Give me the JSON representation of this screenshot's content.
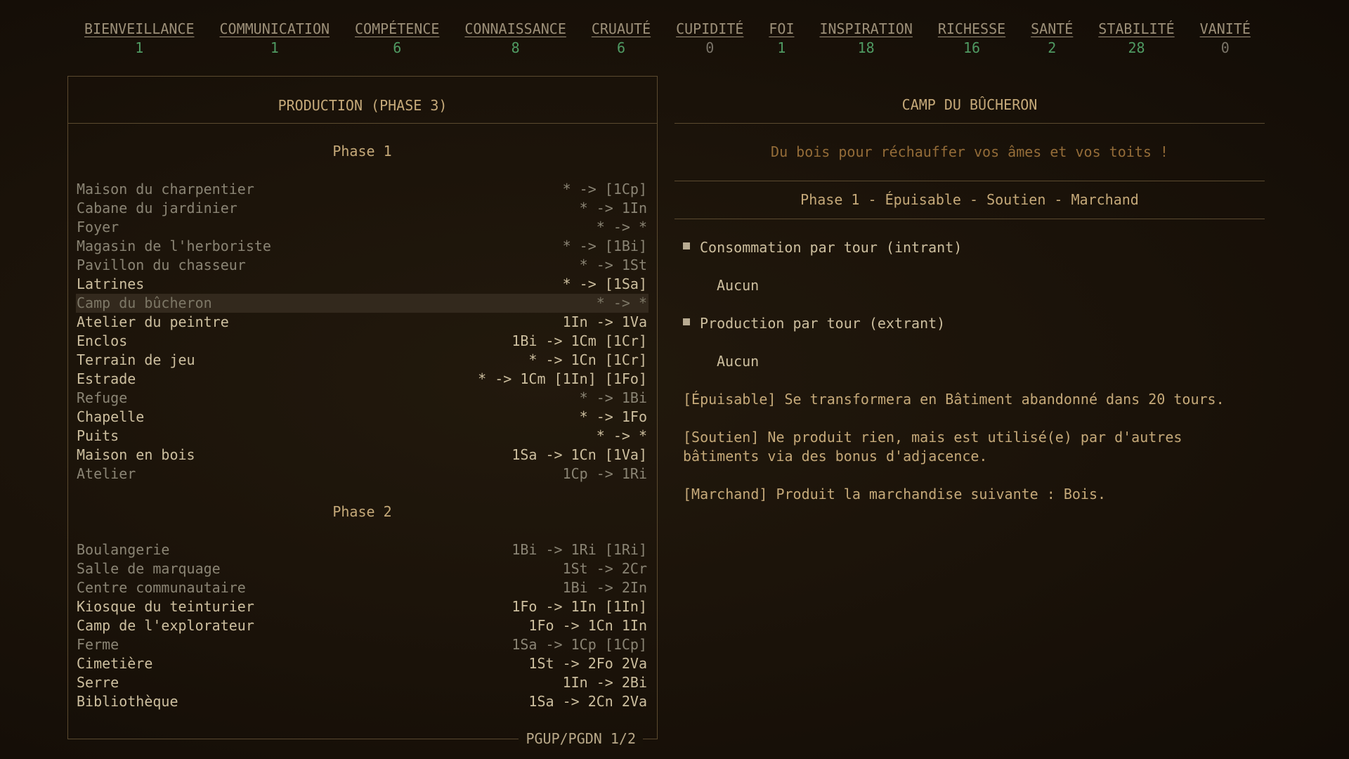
{
  "stats": [
    {
      "name": "BIENVEILLANCE",
      "value": "1"
    },
    {
      "name": "COMMUNICATION",
      "value": "1"
    },
    {
      "name": "COMPÉTENCE",
      "value": "6"
    },
    {
      "name": "CONNAISSANCE",
      "value": "8"
    },
    {
      "name": "CRUAUTÉ",
      "value": "6"
    },
    {
      "name": "CUPIDITÉ",
      "value": "0"
    },
    {
      "name": "FOI",
      "value": "1"
    },
    {
      "name": "INSPIRATION",
      "value": "18"
    },
    {
      "name": "RICHESSE",
      "value": "16"
    },
    {
      "name": "SANTÉ",
      "value": "2"
    },
    {
      "name": "STABILITÉ",
      "value": "28"
    },
    {
      "name": "VANITÉ",
      "value": "0"
    }
  ],
  "production": {
    "title": "PRODUCTION (PHASE 3)",
    "phase1_label": "Phase 1",
    "phase2_label": "Phase 2",
    "phase1_items": [
      {
        "name": "Maison du charpentier",
        "formula": "* -> [1Cp]",
        "state": "dim"
      },
      {
        "name": "Cabane du jardinier",
        "formula": "* -> 1In",
        "state": "dim"
      },
      {
        "name": "Foyer",
        "formula": "* -> *",
        "state": "dim"
      },
      {
        "name": "Magasin de l'herboriste",
        "formula": "* -> [1Bi]",
        "state": "dim"
      },
      {
        "name": "Pavillon du chasseur",
        "formula": "* -> 1St",
        "state": "dim"
      },
      {
        "name": "Latrines",
        "formula": "* -> [1Sa]",
        "state": "bright"
      },
      {
        "name": "Camp du bûcheron",
        "formula": "* -> *",
        "state": "selected"
      },
      {
        "name": "Atelier du peintre",
        "formula": "1In -> 1Va",
        "state": "bright"
      },
      {
        "name": "Enclos",
        "formula": "1Bi -> 1Cm [1Cr]",
        "state": "bright"
      },
      {
        "name": "Terrain de jeu",
        "formula": "* -> 1Cn [1Cr]",
        "state": "bright"
      },
      {
        "name": "Estrade",
        "formula": "* -> 1Cm [1In] [1Fo]",
        "state": "bright"
      },
      {
        "name": "Refuge",
        "formula": "* -> 1Bi",
        "state": "dim"
      },
      {
        "name": "Chapelle",
        "formula": "* -> 1Fo",
        "state": "bright"
      },
      {
        "name": "Puits",
        "formula": "* -> *",
        "state": "bright"
      },
      {
        "name": "Maison en bois",
        "formula": "1Sa -> 1Cn [1Va]",
        "state": "bright"
      },
      {
        "name": "Atelier",
        "formula": "1Cp -> 1Ri",
        "state": "dim"
      }
    ],
    "phase2_items": [
      {
        "name": "Boulangerie",
        "formula": "1Bi -> 1Ri [1Ri]",
        "state": "dim"
      },
      {
        "name": "Salle de marquage",
        "formula": "1St -> 2Cr",
        "state": "dim"
      },
      {
        "name": "Centre communautaire",
        "formula": "1Bi -> 2In",
        "state": "dim"
      },
      {
        "name": "Kiosque du teinturier",
        "formula": "1Fo -> 1In [1In]",
        "state": "bright"
      },
      {
        "name": "Camp de l'explorateur",
        "formula": "1Fo -> 1Cn 1In",
        "state": "bright"
      },
      {
        "name": "Ferme",
        "formula": "1Sa -> 1Cp [1Cp]",
        "state": "dim"
      },
      {
        "name": "Cimetière",
        "formula": "1St -> 2Fo 2Va",
        "state": "bright"
      },
      {
        "name": "Serre",
        "formula": "1In -> 2Bi",
        "state": "bright"
      },
      {
        "name": "Bibliothèque",
        "formula": "1Sa -> 2Cn 2Va",
        "state": "bright"
      }
    ],
    "pager": "PGUP/PGDN 1/2"
  },
  "detail": {
    "title": "CAMP DU BÛCHERON",
    "quote": "Du bois pour réchauffer vos âmes et vos toits !",
    "phase_line": "Phase 1 - Épuisable - Soutien - Marchand",
    "consumption_label": "Consommation par tour (intrant)",
    "consumption_value": "Aucun",
    "production_label": "Production par tour (extrant)",
    "production_value": "Aucun",
    "note_exhaustible": "[Épuisable] Se transformera en Bâtiment abandonné dans 20 tours.",
    "note_support": "[Soutien] Ne produit rien, mais est utilisé(e) par d'autres\nbâtiments via des bonus d'adjacence.",
    "note_merchant": "[Marchand] Produit la marchandise suivante : Bois."
  },
  "colors": {
    "background": "#181108",
    "accent": "#c5a979",
    "stat_value": "#4f9a62",
    "quote": "#946c38",
    "border": "#5b4a2f"
  }
}
